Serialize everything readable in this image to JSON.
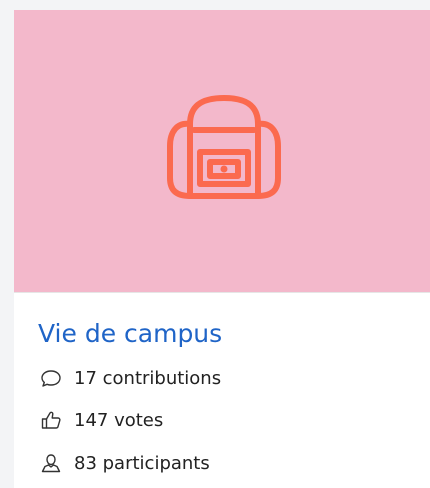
{
  "card": {
    "title": "Vie de campus",
    "accent_color": "#1f64c7",
    "image_background": "#f3b8cb",
    "image_icon": "backpack-icon",
    "image_icon_color": "#fb6a4f",
    "stats": {
      "contributions": {
        "icon": "comment-icon",
        "label": "17 contributions"
      },
      "votes": {
        "icon": "thumbs-up-icon",
        "label": "147 votes"
      },
      "participants": {
        "icon": "user-icon",
        "label": "83 participants"
      }
    }
  }
}
